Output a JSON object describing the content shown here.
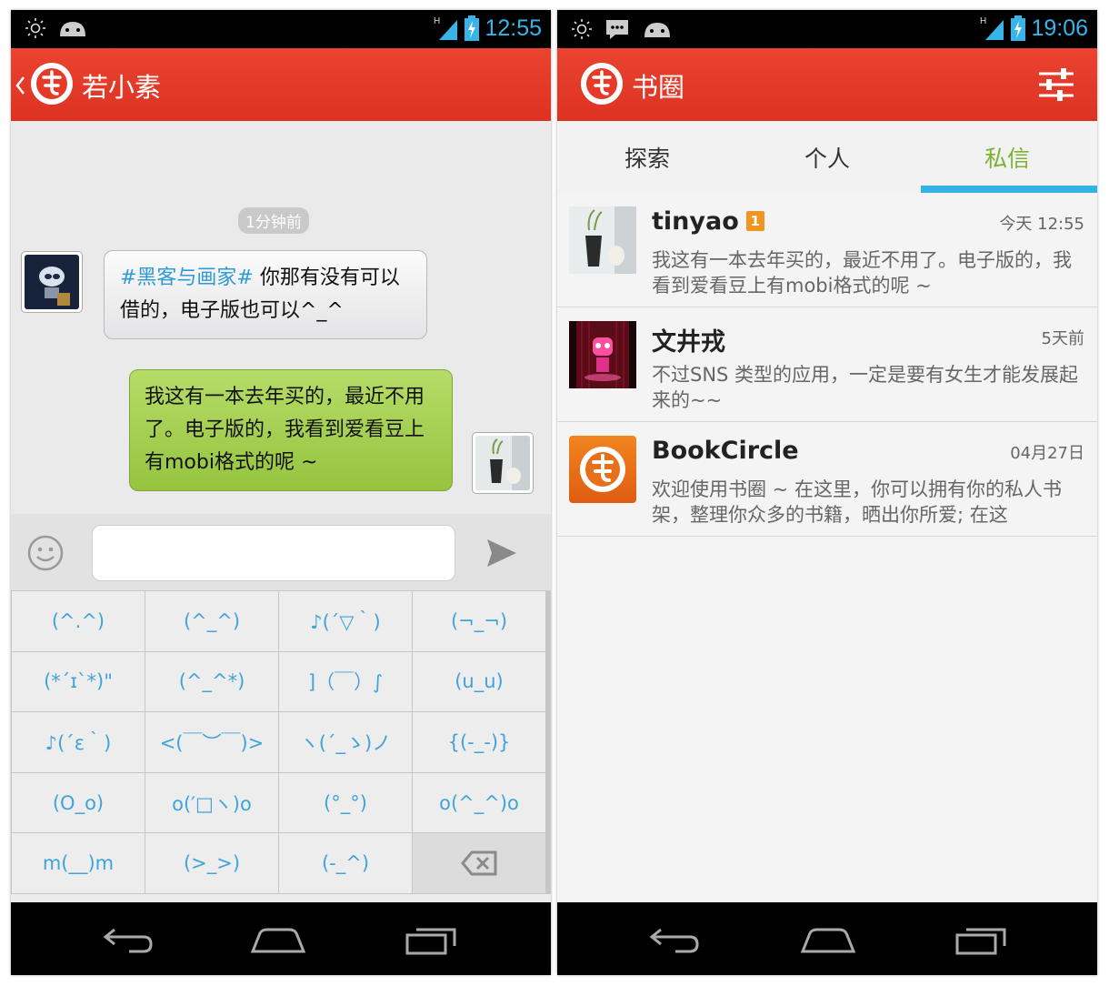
{
  "screen_chat": {
    "status_time": "12:55",
    "back_icon": "chevron-left-icon",
    "title": "若小素",
    "time_divider": "1分钟前",
    "incoming": {
      "tag": "#黑客与画家#",
      "text": " 你那有没有可以借的，电子版也可以^_^"
    },
    "outgoing": {
      "text": "我这有一本去年买的，最近不用了。电子版的，我看到爱看豆上有mobi格式的呢 ~"
    },
    "input": {
      "value": "",
      "placeholder": ""
    },
    "keyboard": {
      "keys": [
        "(^.^)",
        "(^_^)",
        "♪(´▽｀)",
        "(¬_¬)",
        "(*´ɪ`*)\"",
        "(^_^*)",
        "]（￣）∫",
        "(u_u)",
        "♪(´ε｀)",
        "<(￣︶￣)>",
        "ヽ(´_ゝ)ノ",
        "{(-_-)}",
        "(O_o)",
        "o(′□ヽ)o",
        "(°_°)",
        "o(^_^)o",
        "m(__)m",
        "(>_>)",
        "(-_^)"
      ],
      "delete_icon": "backspace-icon"
    }
  },
  "screen_messages": {
    "status_time": "19:06",
    "title": "书圈",
    "settings_icon": "sliders-icon",
    "tabs": [
      {
        "label": "探索",
        "active": false
      },
      {
        "label": "个人",
        "active": false
      },
      {
        "label": "私信",
        "active": true
      }
    ],
    "conversations": [
      {
        "name": "tinyao",
        "badge": "1",
        "time": "今天 12:55",
        "preview": "我这有一本去年买的，最近不用了。电子版的，我看到爱看豆上有mobi格式的呢 ~"
      },
      {
        "name": "文井戎",
        "badge": "",
        "time": "5天前",
        "preview": "不过SNS 类型的应用，一定是要有女生才能发展起来的~~"
      },
      {
        "name": "BookCircle",
        "badge": "",
        "time": "04月27日",
        "preview": "欢迎使用书圈 ~  在这里，你可以拥有你的私人书架，整理你众多的书籍，晒出你所爱; 在这"
      }
    ]
  },
  "colors": {
    "app_red": "#e53a28",
    "bubble_green": "#a3cf52",
    "accent_blue": "#35b2e4",
    "tab_active_green": "#7cb231",
    "badge_orange": "#f0961e"
  }
}
